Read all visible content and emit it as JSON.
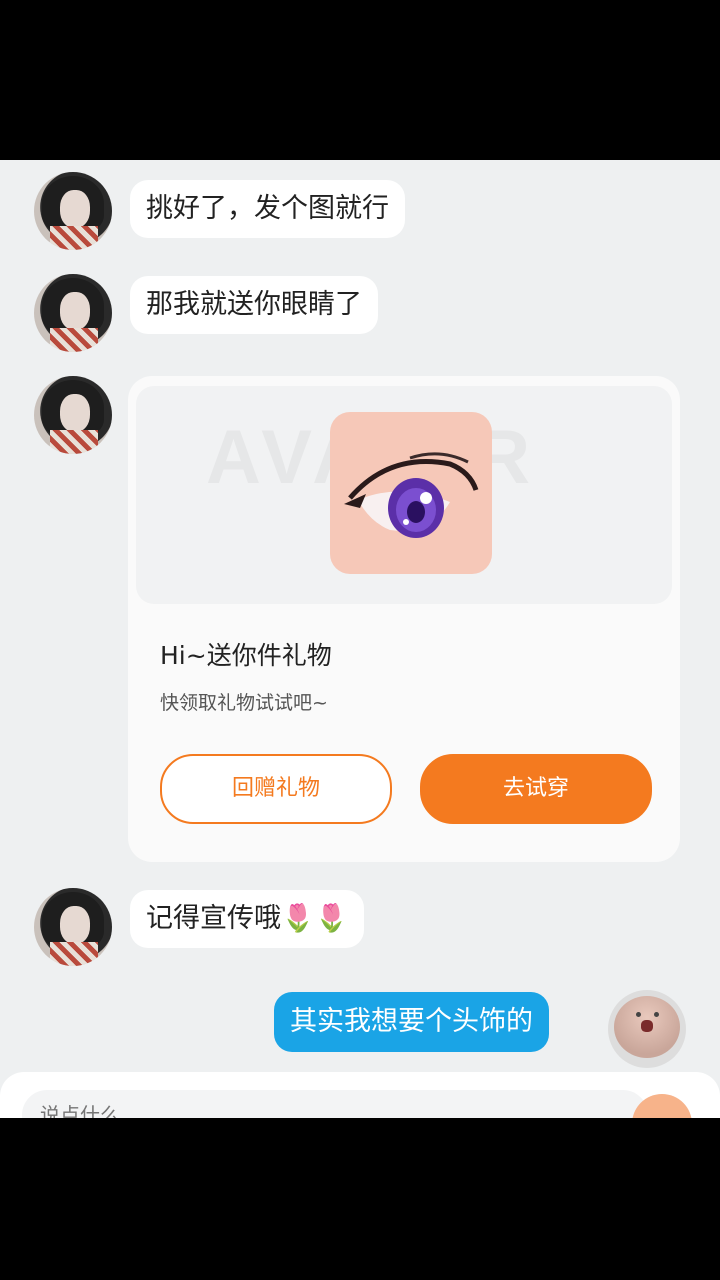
{
  "messages": [
    {
      "from": "her",
      "text": "挑好了，发个图就行"
    },
    {
      "from": "her",
      "text": "那我就送你眼睛了"
    },
    {
      "from": "her",
      "text": "记得宣传哦🌷🌷"
    },
    {
      "from": "me",
      "text": "其实我想要个头饰的"
    }
  ],
  "gift_card": {
    "watermark": "AVATAR",
    "title": "Hi~送你件礼物",
    "subtitle": "快领取礼物试试吧~",
    "return_gift_label": "回赠礼物",
    "try_on_label": "去试穿"
  },
  "input": {
    "placeholder": "说点什么..."
  },
  "colors": {
    "accent": "#f47a1f",
    "my_bubble": "#1aa4e6",
    "background": "#eef0f1"
  }
}
